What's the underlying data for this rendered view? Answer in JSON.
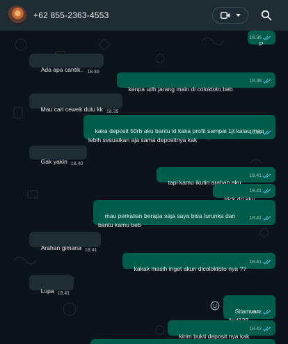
{
  "header": {
    "contact_name": "+62 855-2363-4553",
    "icons": {
      "video": "video-call-icon",
      "dropdown": "chevron-down-icon",
      "search": "search-icon"
    }
  },
  "colors": {
    "incoming_bubble": "#202c33",
    "outgoing_bubble": "#005c4b",
    "read_ticks": "#53bdeb",
    "chat_background": "#0b141a"
  },
  "messages": [
    {
      "dir": "out",
      "text": "P",
      "time": "18.36",
      "ticks": "read"
    },
    {
      "dir": "in",
      "text": "Ada apa cantik..",
      "time": "18.36"
    },
    {
      "dir": "out",
      "text": "kenpa udh jarang main di coloktoto beb",
      "time": "18.38",
      "ticks": "read"
    },
    {
      "dir": "in",
      "text": "Mau cari cewek dulu kk",
      "time": "18.39"
    },
    {
      "dir": "out",
      "text": "kaka deposit 50rb aku bantu id kaka profit sampai 1jt kalau mau lebih sesuaikan aja sama depositnya kak",
      "time": "18.39",
      "ticks": "read"
    },
    {
      "dir": "in",
      "text": "Gak yakin",
      "time": "18.40"
    },
    {
      "dir": "out",
      "text": "tapi kamu ikutin arahan aku",
      "time": "18.41",
      "ticks": "read"
    },
    {
      "dir": "out",
      "text": "trick dri aku",
      "time": "18.41",
      "ticks": "read"
    },
    {
      "dir": "out",
      "text": "mau perkalian berapa saja saya bisa turunka dan bantu kamu beb",
      "time": "18.41",
      "ticks": "read"
    },
    {
      "dir": "in",
      "text": "Arahan gimana",
      "time": "18.41"
    },
    {
      "dir": "out",
      "text": "kakak masih inget akun dicoloktoto nya ??",
      "time": "18.41",
      "ticks": "read"
    },
    {
      "dir": "in",
      "text": "Lupa",
      "time": "18.41"
    },
    {
      "dir": "out",
      "text": "Sitamvan\nAsd123",
      "time": "18.42",
      "ticks": "read"
    },
    {
      "dir": "out",
      "text": "kirim bukti deposit nya kak",
      "time": "18.42",
      "ticks": "read"
    },
    {
      "dir": "out",
      "text": "",
      "time": "",
      "ticks": ""
    }
  ],
  "chat_actions": {
    "react_icon": "emoji-react-icon"
  }
}
